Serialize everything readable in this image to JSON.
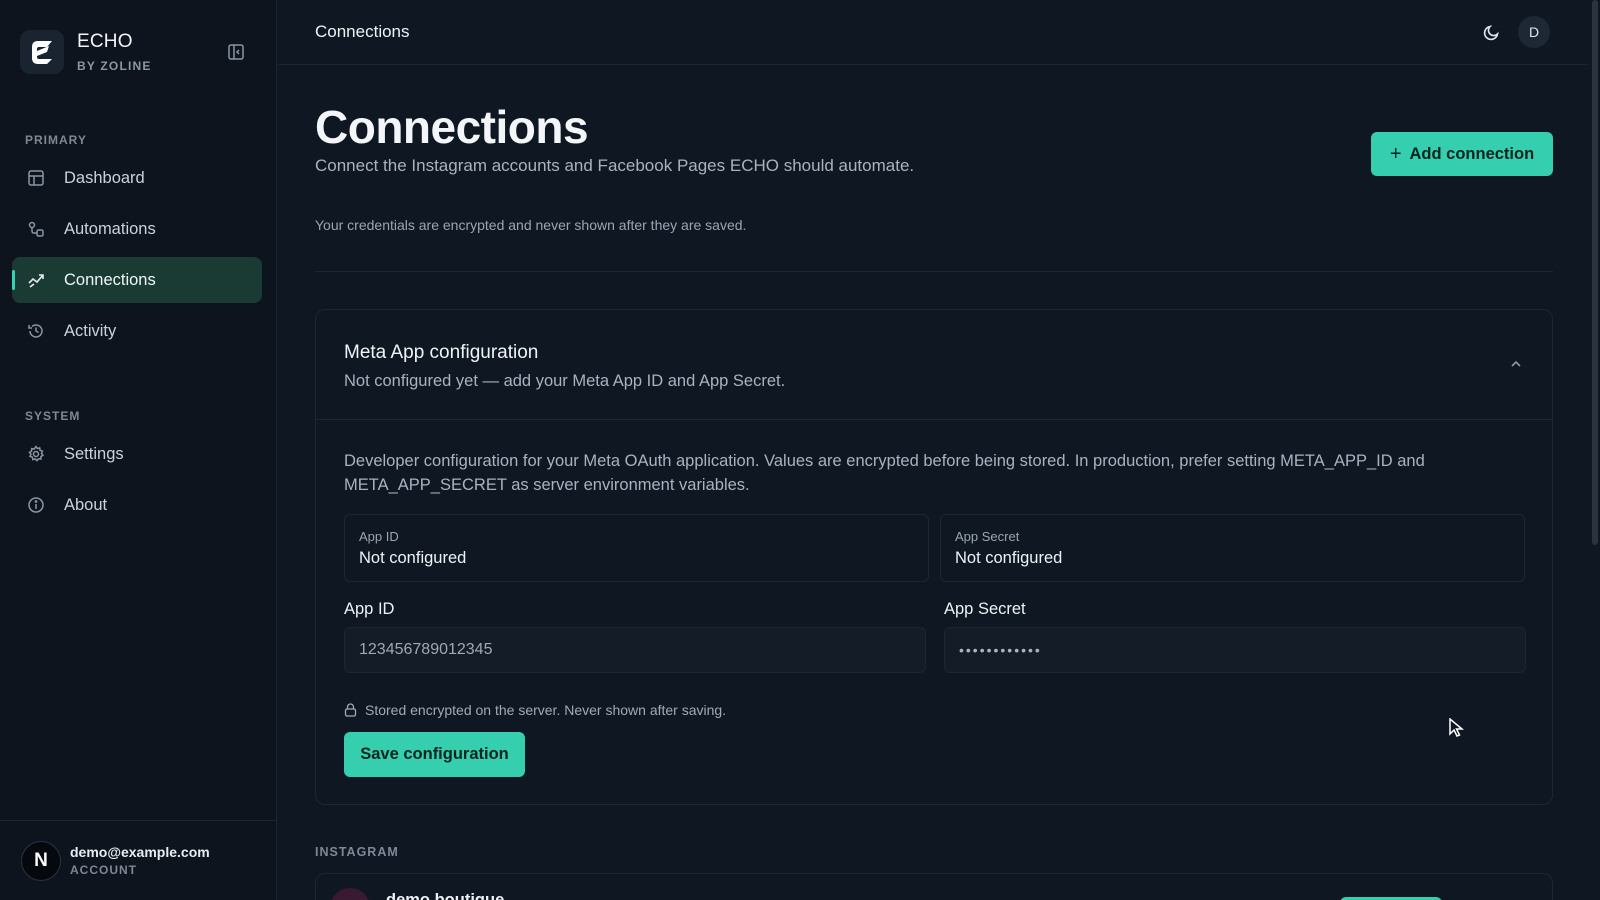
{
  "brand": {
    "name": "ECHO",
    "subtitle": "BY ZOLINE"
  },
  "sidebar": {
    "primary_label": "PRIMARY",
    "primary_items": [
      {
        "label": "Dashboard",
        "icon": "dashboard-icon"
      },
      {
        "label": "Automations",
        "icon": "automations-icon"
      },
      {
        "label": "Connections",
        "icon": "connections-icon",
        "active": true
      },
      {
        "label": "Activity",
        "icon": "history-icon"
      }
    ],
    "system_label": "SYSTEM",
    "system_items": [
      {
        "label": "Settings",
        "icon": "gear-icon"
      },
      {
        "label": "About",
        "icon": "info-icon"
      }
    ],
    "footer": {
      "avatar_letter": "N",
      "email": "demo@example.com",
      "role": "ACCOUNT"
    }
  },
  "topbar": {
    "title": "Connections",
    "avatar_letter": "D"
  },
  "page": {
    "title": "Connections",
    "subtitle": "Connect the Instagram accounts and Facebook Pages ECHO should automate.",
    "add_button": "Add connection",
    "credentials_note": "Your credentials are encrypted and never shown after they are saved."
  },
  "meta_card": {
    "title": "Meta App configuration",
    "status": "Not configured yet — add your Meta App ID and App Secret.",
    "description": "Developer configuration for your Meta OAuth application. Values are encrypted before being stored. In production, prefer setting META_APP_ID and META_APP_SECRET as server environment variables.",
    "app_id_stat": {
      "label": "App ID",
      "value": "Not configured"
    },
    "app_secret_stat": {
      "label": "App Secret",
      "value": "Not configured"
    },
    "app_id_field": {
      "label": "App ID",
      "placeholder": "123456789012345"
    },
    "app_secret_field": {
      "label": "App Secret",
      "placeholder": "••••••••••••"
    },
    "encrypted_note": "Stored encrypted on the server. Never shown after saving.",
    "save_button": "Save configuration"
  },
  "instagram": {
    "section_label": "INSTAGRAM",
    "account_name": "demo.boutique"
  },
  "colors": {
    "accent": "#35cfb0",
    "background": "#0f1722",
    "sidebar": "#0d141e",
    "active_nav": "#1a3b33"
  }
}
